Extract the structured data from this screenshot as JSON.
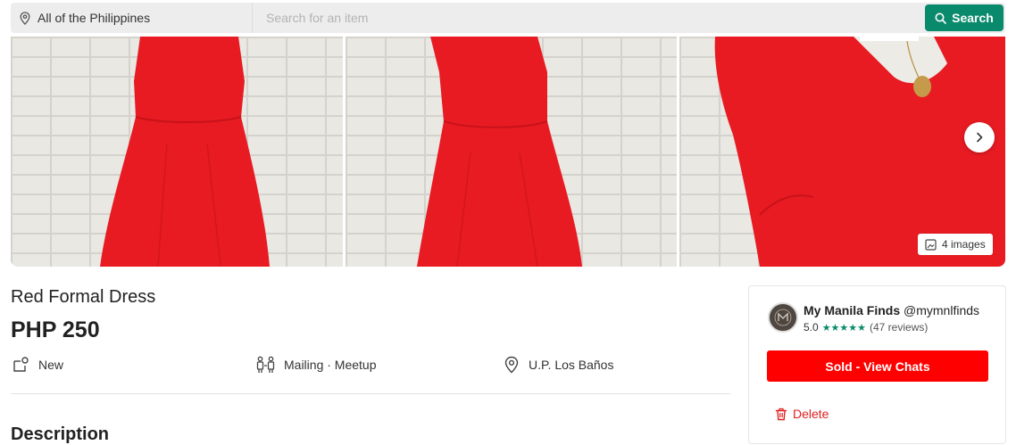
{
  "search_bar": {
    "location": "All of the Philippines",
    "placeholder": "Search for an item",
    "button_label": "Search"
  },
  "gallery": {
    "image_count_label": "4 images",
    "icons": [
      "location-pin-icon",
      "search-icon",
      "chevron-right-icon",
      "images-icon"
    ]
  },
  "listing": {
    "title": "Red Formal Dress",
    "price": "PHP 250",
    "condition": "New",
    "delivery": "Mailing · Meetup",
    "location": "U.P. Los Baños",
    "description_heading": "Description"
  },
  "seller": {
    "name": "My Manila Finds",
    "handle": "@mymnlfinds",
    "rating": "5.0",
    "stars": "★★★★★",
    "reviews": "(47 reviews)",
    "sold_button_label": "Sold - View Chats",
    "delete_label": "Delete"
  },
  "colors": {
    "accent": "#0a8a6c",
    "sold_button": "#ff0000",
    "delete_text": "#e02020",
    "dress_red": "#e81b22"
  }
}
